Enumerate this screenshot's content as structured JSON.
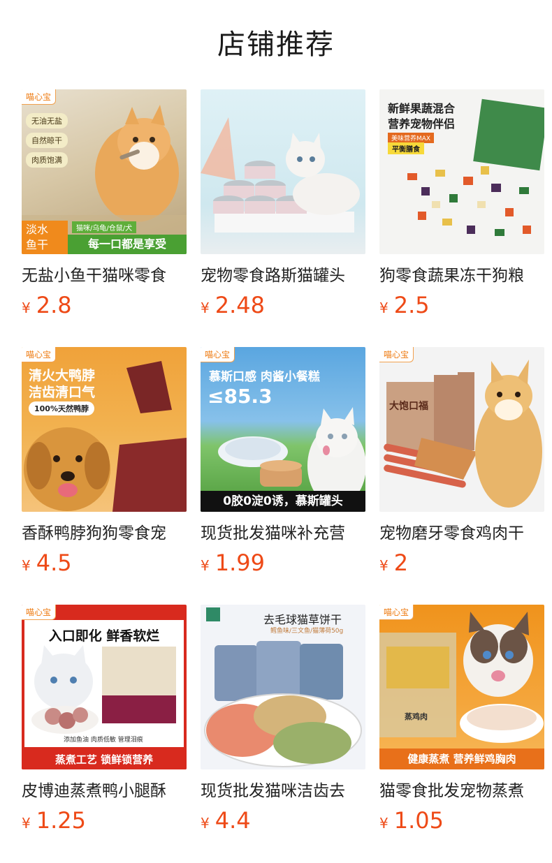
{
  "header": {
    "title": "店铺推荐"
  },
  "products": [
    {
      "name": "无盐小鱼干猫咪零食",
      "currency": "¥",
      "price": "2.8",
      "image": {
        "brand": "喵心宝",
        "tags": [
          "无油无盐",
          "自然晾干",
          "肉质饱满"
        ],
        "badge1": "淡水",
        "badge2": "鱼干",
        "sub": "猫咪/乌龟/仓鼠/犬",
        "slogan": "每一口都是享受"
      }
    },
    {
      "name": "宠物零食路斯猫罐头",
      "currency": "¥",
      "price": "2.48",
      "image": {}
    },
    {
      "name": "狗零食蔬果冻干狗粮",
      "currency": "¥",
      "price": "2.5",
      "image": {
        "line1": "新鲜果蔬混合",
        "line2": "营养宠物伴侣",
        "chip1": "美味营养MAX",
        "chip2": "平衡膳食"
      }
    },
    {
      "name": "香酥鸭脖狗狗零食宠",
      "currency": "¥",
      "price": "4.5",
      "image": {
        "brand": "喵心宝",
        "line1": "清火大鸭脖",
        "line2": "洁齿清口气",
        "chip": "100%天然鸭脖"
      }
    },
    {
      "name": "现货批发猫咪补充营",
      "currency": "¥",
      "price": "1.99",
      "image": {
        "brand": "喵心宝",
        "headline": "慕斯口感 肉酱小餐糕",
        "big": "≤85.3",
        "bottom": "0胶0淀0诱，慕斯罐头"
      }
    },
    {
      "name": "宠物磨牙零食鸡肉干",
      "currency": "¥",
      "price": "2",
      "image": {
        "brand": "喵心宝",
        "pack": "大饱口福"
      }
    },
    {
      "name": "皮博迪蒸煮鸭小腿酥",
      "currency": "¥",
      "price": "1.25",
      "image": {
        "brand": "喵心宝",
        "headline": "入口即化 鲜香软烂",
        "note": "添加鱼油 肉质低敏 管理泪痕",
        "bottom": "蒸煮工艺 锁鲜锁营养"
      }
    },
    {
      "name": "现货批发猫咪洁齿去",
      "currency": "¥",
      "price": "4.4",
      "image": {
        "headline": "去毛球猫草饼干",
        "sub": "鳕鱼味/三文鱼/猫薄荷50g"
      }
    },
    {
      "name": "猫零食批发宠物蒸煮",
      "currency": "¥",
      "price": "1.05",
      "image": {
        "brand": "喵心宝",
        "pack": "蒸鸡肉",
        "bottom": "健康蒸煮 营养鲜鸡胸肉"
      }
    }
  ],
  "colors": {
    "price": "#ee4a17",
    "accent_orange": "#f08a1c",
    "accent_red": "#d82a1e"
  }
}
